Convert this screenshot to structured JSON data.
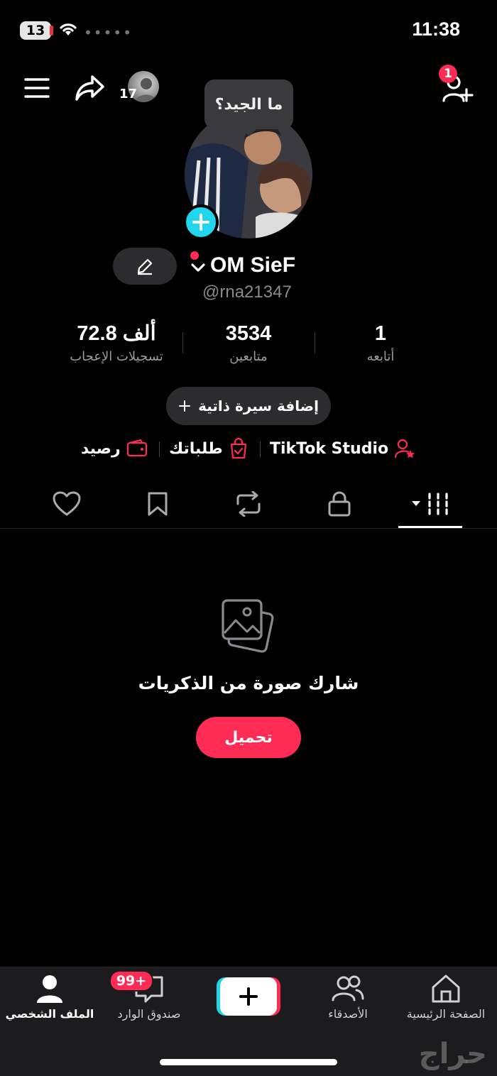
{
  "status_bar": {
    "battery": "13",
    "time": "11:38"
  },
  "header": {
    "story_count": "17",
    "follow_requests_badge": "1"
  },
  "tooltip": "ما الجيد؟",
  "profile": {
    "display_name": "OM SieF",
    "username": "@rna21347"
  },
  "stats": [
    {
      "value": "72.8 ألف",
      "label": "تسجيلات الإعجاب"
    },
    {
      "value": "3534",
      "label": "متابعين"
    },
    {
      "value": "1",
      "label": "أتابعه"
    }
  ],
  "bio_button": "إضافة سيرة ذاتية",
  "links": {
    "studio": "TikTok Studio",
    "orders": "طلباتك",
    "balance": "رصيد"
  },
  "empty_state": {
    "title": "شارك صورة من الذكريات",
    "button": "تحميل"
  },
  "nav": {
    "home": "الصفحة الرئيسية",
    "friends": "الأصدقاء",
    "inbox": "صندوق الوارد",
    "inbox_badge": "99+",
    "profile": "الملف الشخصي"
  },
  "watermark": "حراج",
  "colors": {
    "accent": "#fe2c55",
    "cyan": "#20d5ec",
    "background": "#000000",
    "nav_background": "#1c1c1e"
  }
}
